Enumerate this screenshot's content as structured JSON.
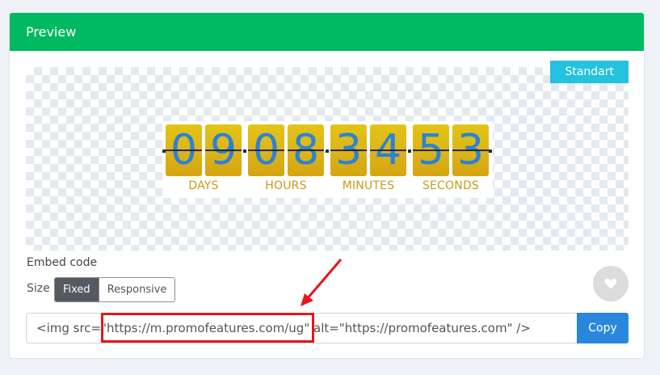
{
  "header": {
    "title": "Preview"
  },
  "preview": {
    "badge": "Standart",
    "digits": [
      "0",
      "9",
      "0",
      "8",
      "3",
      "4",
      "5",
      "3"
    ],
    "labels": [
      "DAYS",
      "HOURS",
      "MINUTES",
      "SECONDS"
    ],
    "colors": {
      "digit_face": "#dcb51a",
      "digit_text": "#2b82d7",
      "label_text": "#c79b16"
    }
  },
  "embed": {
    "label": "Embed code",
    "size_label": "Size",
    "size_options": [
      "Fixed",
      "Responsive"
    ],
    "size_selected": "Fixed",
    "code": "<img src=\"https://m.promofeatures.com/ug\" alt=\"https://promofeatures.com\" />",
    "copy_label": "Copy"
  },
  "icons": {
    "favorite": "heart-icon",
    "annotation": "red-arrow"
  },
  "colors": {
    "header_bg": "#00b960",
    "badge_bg": "#24c2df",
    "copy_bg": "#2b87dc",
    "annotation": "#e8141b"
  }
}
